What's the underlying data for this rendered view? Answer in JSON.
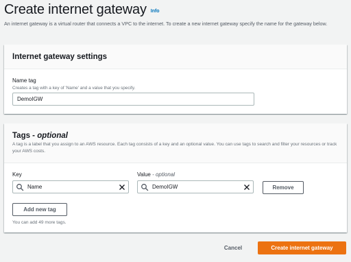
{
  "page": {
    "title": "Create internet gateway",
    "info_label": "Info",
    "description": "An internet gateway is a virtual router that connects a VPC to the internet. To create a new internet gateway specify the name for the gateway below."
  },
  "settings_panel": {
    "title": "Internet gateway settings",
    "name_tag": {
      "label": "Name tag",
      "description": "Creates a tag with a key of 'Name' and a value that you specify.",
      "value": "DemoIGW"
    }
  },
  "tags_panel": {
    "title": "Tags - ",
    "title_optional": "optional",
    "description": "A tag is a label that you assign to an AWS resource. Each tag consists of a key and an optional value. You can use tags to search and filter your resources or track your AWS costs.",
    "key_label": "Key",
    "value_label": "Value",
    "value_optional": " - optional",
    "tags": [
      {
        "key": "Name",
        "value": "DemoIGW"
      }
    ],
    "remove_label": "Remove",
    "add_label": "Add new tag",
    "hint": "You can add 49 more tags."
  },
  "footer": {
    "cancel_label": "Cancel",
    "create_label": "Create internet gateway"
  },
  "colors": {
    "primary": "#ec7211",
    "link": "#0073bb",
    "background": "#f2f3f3"
  },
  "icons": [
    "search-icon",
    "clear-icon"
  ]
}
